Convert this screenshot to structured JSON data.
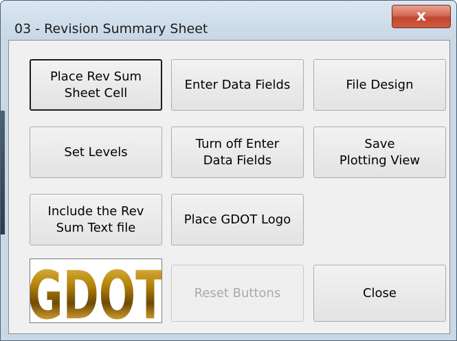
{
  "window": {
    "title": "03 - Revision Summary Sheet",
    "close_glyph": "x"
  },
  "buttons": {
    "place_rev_sum": "Place Rev Sum\nSheet Cell",
    "enter_data_fields": "Enter Data Fields",
    "file_design": "File Design",
    "set_levels": "Set Levels",
    "turn_off_enter": "Turn off Enter\nData Fields",
    "save_plotting": "Save\nPlotting View",
    "include_rev_sum": "Include the Rev\nSum Text file",
    "place_gdot_logo": "Place GDOT Logo",
    "reset_buttons": "Reset Buttons",
    "close": "Close"
  },
  "logo": {
    "text": "GDOT"
  },
  "colors": {
    "logo_gold": "#b8860b",
    "logo_dark": "#5a3d00",
    "titlebar": "#c8d7e6"
  }
}
